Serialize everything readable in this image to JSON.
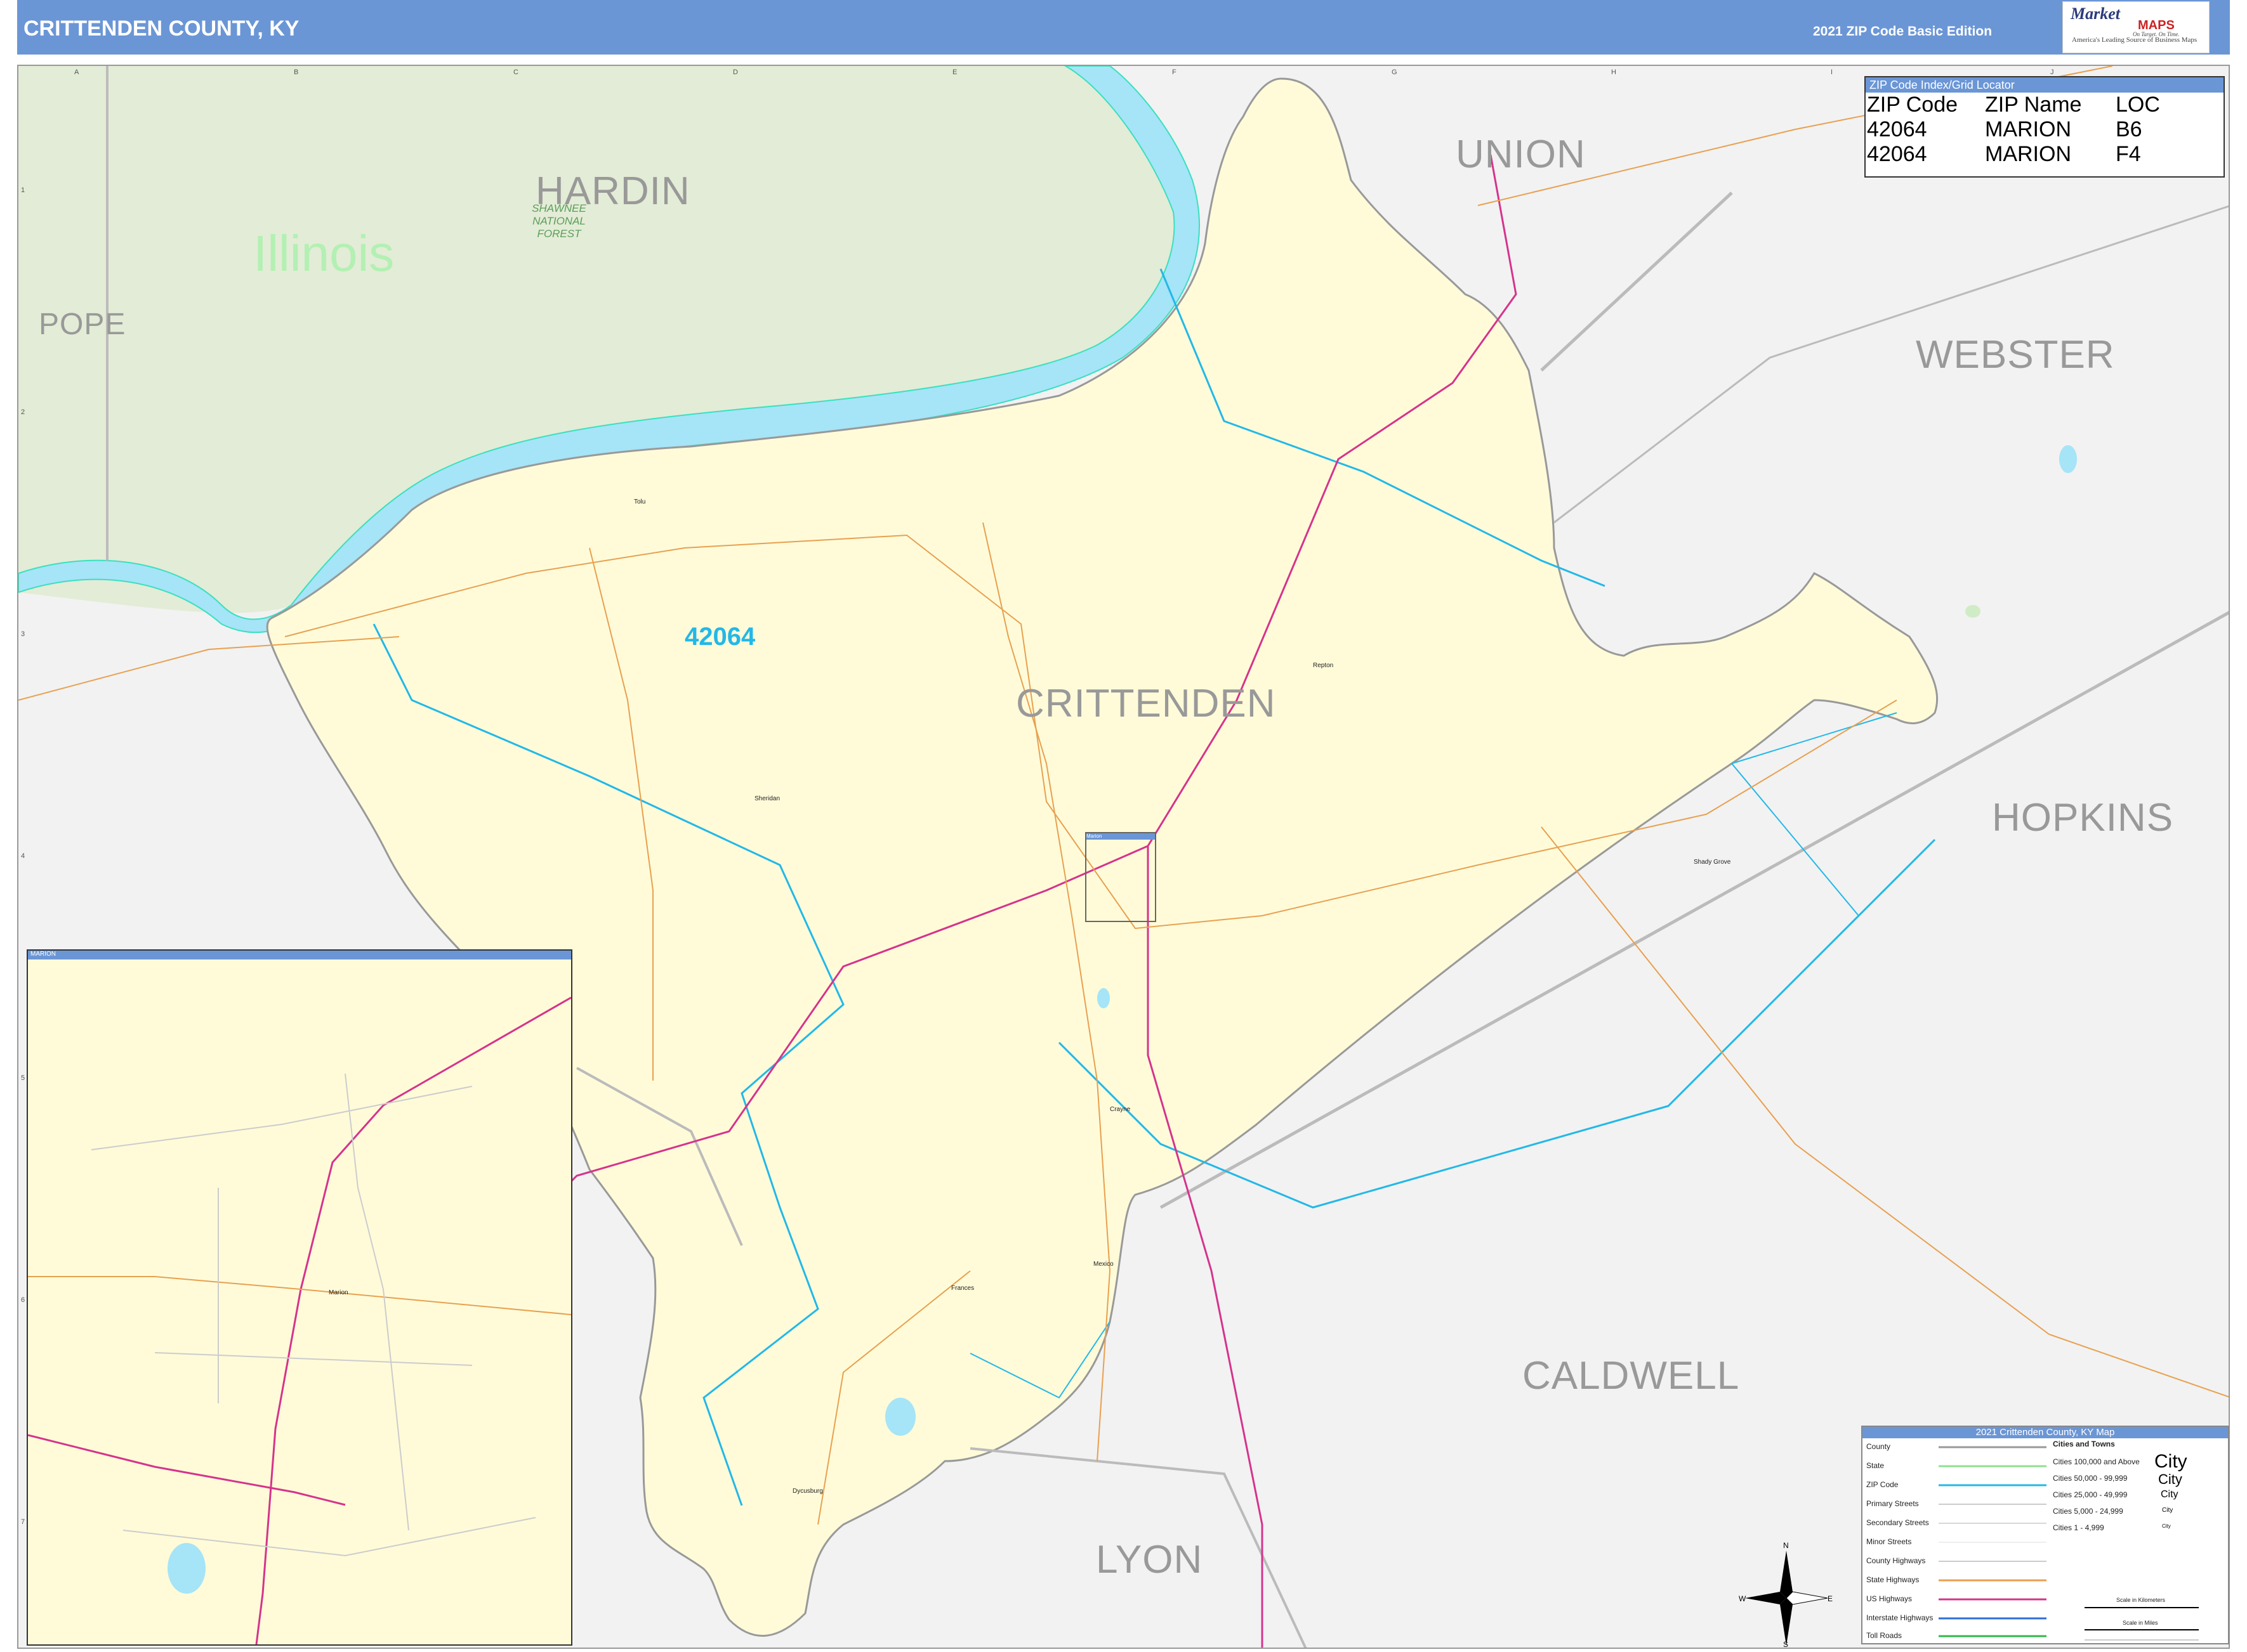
{
  "header": {
    "title": "CRITTENDEN COUNTY, KY",
    "edition": "2021 ZIP Code Basic Edition",
    "logo_brand": "Market",
    "logo_brand2": "MAPS",
    "logo_tag": "America's Leading Source of Business Maps",
    "logo_slogan": "On Target. On Time."
  },
  "grid": {
    "columns": [
      "A",
      "B",
      "C",
      "D",
      "E",
      "F",
      "G",
      "H",
      "I",
      "J"
    ],
    "rows": [
      "1",
      "2",
      "3",
      "4",
      "5",
      "6",
      "7"
    ]
  },
  "zip_index": {
    "caption": "ZIP Code Index/Grid Locator",
    "headers": [
      "ZIP Code",
      "ZIP Name",
      "LOC"
    ],
    "rows": [
      [
        "42064",
        "MARION",
        "B6"
      ],
      [
        "42064",
        "MARION",
        "F4"
      ]
    ]
  },
  "labels": {
    "counties": [
      "HARDIN",
      "UNION",
      "POPE",
      "WEBSTER",
      "CRITTENDEN",
      "HOPKINS",
      "CALDWELL",
      "LYON"
    ],
    "state": "Illinois",
    "zip": "42064",
    "forest": "SHAWNEE NATIONAL FOREST",
    "towns": [
      "Tolu",
      "Repton",
      "Sheridan",
      "Marion",
      "Shady Grove",
      "Crayne",
      "Mexico",
      "Frances",
      "Dycusburg"
    ],
    "inset_caption": "MARION",
    "inset_town": "Marion"
  },
  "legend": {
    "caption": "2021 Crittenden County, KY Map",
    "line_items": [
      "County",
      "State",
      "ZIP Code",
      "Primary Streets",
      "Secondary Streets",
      "Minor Streets",
      "County Highways",
      "State Highways",
      "US Highways",
      "Interstate Highways",
      "Toll Roads"
    ],
    "city_header": "Cities and Towns",
    "city_items": [
      "Cities 100,000 and Above",
      "Cities 50,000 - 99,999",
      "Cities 25,000 - 49,999",
      "Cities 5,000 - 24,999",
      "Cities 1 - 4,999"
    ],
    "city_samples": [
      "City",
      "City",
      "City",
      "City",
      "City"
    ],
    "scale_km": "Scale in Kilometers",
    "scale_mi": "Scale in Miles"
  },
  "compass": {
    "n": "N",
    "s": "S",
    "e": "E",
    "w": "W"
  },
  "colors": {
    "header": "#6b96d6",
    "county_fill": "#fffbd9",
    "illinois_fill": "#e3ecd6",
    "river": "#a6e4f7",
    "zip_boundary": "#22b8e8",
    "us_highway": "#d6338c",
    "state_highway": "#e8a050",
    "county_boundary": "#999999"
  }
}
